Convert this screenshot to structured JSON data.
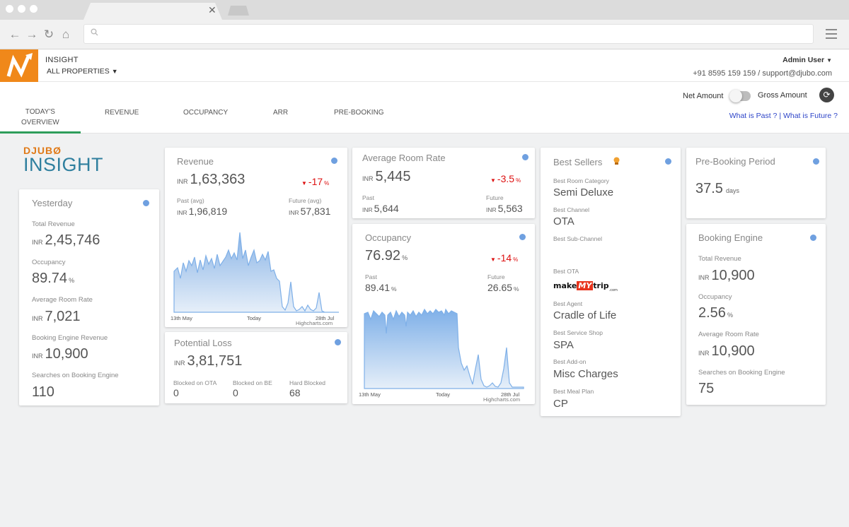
{
  "browser": {
    "search_icon": "magnifier-icon"
  },
  "header": {
    "app_title": "INSIGHT",
    "property": "ALL PROPERTIES",
    "user": "Admin User",
    "contact": "+91 8595 159 159 / support@djubo.com"
  },
  "tabs": [
    {
      "line1": "TODAY'S",
      "line2": "OVERVIEW"
    },
    {
      "line1": "REVENUE",
      "line2": ""
    },
    {
      "line1": "OCCUPANCY",
      "line2": ""
    },
    {
      "line1": "ARR",
      "line2": ""
    },
    {
      "line1": "PRE-BOOKING",
      "line2": ""
    }
  ],
  "controls": {
    "net_label": "Net Amount",
    "gross_label": "Gross Amount",
    "what_past": "What is Past ?",
    "separator": " | ",
    "what_future": "What is Future ?"
  },
  "brand": {
    "top": "DJUBØ",
    "insight": "INSIGHT"
  },
  "yesterday": {
    "title": "Yesterday",
    "total_revenue_label": "Total Revenue",
    "total_revenue": "2,45,746",
    "occupancy_label": "Occupancy",
    "occupancy": "89.74",
    "arr_label": "Average Room Rate",
    "arr": "7,021",
    "be_revenue_label": "Booking Engine Revenue",
    "be_revenue": "10,900",
    "searches_label": "Searches on Booking Engine",
    "searches": "110"
  },
  "currency": "INR",
  "percent": "%",
  "days": "days",
  "revenue": {
    "title": "Revenue",
    "value": "1,63,363",
    "delta": "-17",
    "past_label": "Past (avg)",
    "past": "1,96,819",
    "future_label": "Future (avg)",
    "future": "57,831",
    "axis_start": "13th May",
    "axis_mid": "Today",
    "axis_end": "28th Jul",
    "credit": "Highcharts.com"
  },
  "potential_loss": {
    "title": "Potential Loss",
    "value": "3,81,751",
    "ota_label": "Blocked on OTA",
    "ota": "0",
    "be_label": "Blocked on BE",
    "be": "0",
    "hard_label": "Hard Blocked",
    "hard": "68"
  },
  "arr": {
    "title": "Average Room Rate",
    "value": "5,445",
    "delta": "-3.5",
    "past_label": "Past",
    "past": "5,644",
    "future_label": "Future",
    "future": "5,563"
  },
  "occupancy": {
    "title": "Occupancy",
    "value": "76.92",
    "delta": "-14",
    "past_label": "Past",
    "past": "89.41",
    "future_label": "Future",
    "future": "26.65",
    "axis_start": "13th May",
    "axis_mid": "Today",
    "axis_end": "28th Jul",
    "credit": "Highcharts.com"
  },
  "best_sellers": {
    "title": "Best Sellers",
    "room_cat_label": "Best Room Category",
    "room_cat": "Semi Deluxe",
    "channel_label": "Best Channel",
    "channel": "OTA",
    "subchannel_label": "Best Sub-Channel",
    "ota_label": "Best OTA",
    "ota_logo_a": "make",
    "ota_logo_b": "MY",
    "ota_logo_c": "trip",
    "ota_logo_d": ".com",
    "agent_label": "Best Agent",
    "agent": "Cradle of Life",
    "service_label": "Best Service Shop",
    "service": "SPA",
    "addon_label": "Best Add-on",
    "addon": "Misc Charges",
    "meal_label": "Best Meal Plan",
    "meal": "CP"
  },
  "prebooking": {
    "title": "Pre-Booking Period",
    "value": "37.5"
  },
  "booking_engine": {
    "title": "Booking Engine",
    "total_revenue_label": "Total Revenue",
    "total_revenue": "10,900",
    "occupancy_label": "Occupancy",
    "occupancy": "2.56",
    "arr_label": "Average Room Rate",
    "arr": "10,900",
    "searches_label": "Searches on Booking Engine",
    "searches": "75"
  }
}
